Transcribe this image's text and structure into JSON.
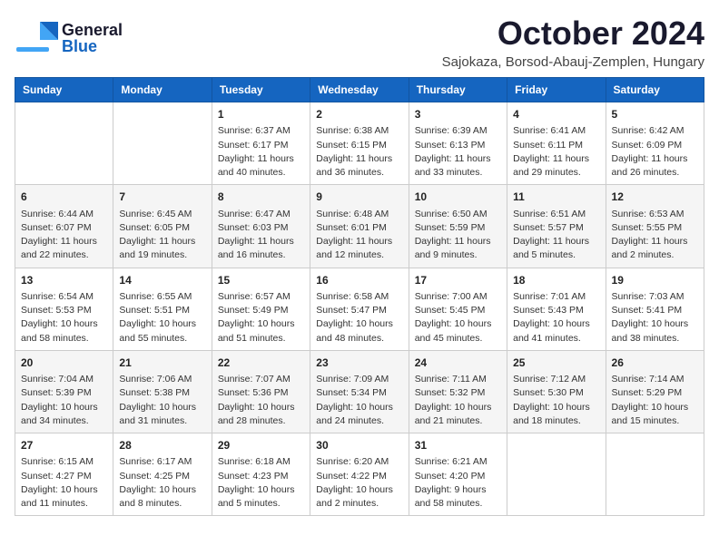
{
  "header": {
    "logo": {
      "line1": "General",
      "line2": "Blue"
    },
    "title": "October 2024",
    "subtitle": "Sajokaza, Borsod-Abauj-Zemplen, Hungary"
  },
  "days_of_week": [
    "Sunday",
    "Monday",
    "Tuesday",
    "Wednesday",
    "Thursday",
    "Friday",
    "Saturday"
  ],
  "weeks": [
    [
      {
        "day": "",
        "content": ""
      },
      {
        "day": "",
        "content": ""
      },
      {
        "day": "1",
        "content": "Sunrise: 6:37 AM\nSunset: 6:17 PM\nDaylight: 11 hours and 40 minutes."
      },
      {
        "day": "2",
        "content": "Sunrise: 6:38 AM\nSunset: 6:15 PM\nDaylight: 11 hours and 36 minutes."
      },
      {
        "day": "3",
        "content": "Sunrise: 6:39 AM\nSunset: 6:13 PM\nDaylight: 11 hours and 33 minutes."
      },
      {
        "day": "4",
        "content": "Sunrise: 6:41 AM\nSunset: 6:11 PM\nDaylight: 11 hours and 29 minutes."
      },
      {
        "day": "5",
        "content": "Sunrise: 6:42 AM\nSunset: 6:09 PM\nDaylight: 11 hours and 26 minutes."
      }
    ],
    [
      {
        "day": "6",
        "content": "Sunrise: 6:44 AM\nSunset: 6:07 PM\nDaylight: 11 hours and 22 minutes."
      },
      {
        "day": "7",
        "content": "Sunrise: 6:45 AM\nSunset: 6:05 PM\nDaylight: 11 hours and 19 minutes."
      },
      {
        "day": "8",
        "content": "Sunrise: 6:47 AM\nSunset: 6:03 PM\nDaylight: 11 hours and 16 minutes."
      },
      {
        "day": "9",
        "content": "Sunrise: 6:48 AM\nSunset: 6:01 PM\nDaylight: 11 hours and 12 minutes."
      },
      {
        "day": "10",
        "content": "Sunrise: 6:50 AM\nSunset: 5:59 PM\nDaylight: 11 hours and 9 minutes."
      },
      {
        "day": "11",
        "content": "Sunrise: 6:51 AM\nSunset: 5:57 PM\nDaylight: 11 hours and 5 minutes."
      },
      {
        "day": "12",
        "content": "Sunrise: 6:53 AM\nSunset: 5:55 PM\nDaylight: 11 hours and 2 minutes."
      }
    ],
    [
      {
        "day": "13",
        "content": "Sunrise: 6:54 AM\nSunset: 5:53 PM\nDaylight: 10 hours and 58 minutes."
      },
      {
        "day": "14",
        "content": "Sunrise: 6:55 AM\nSunset: 5:51 PM\nDaylight: 10 hours and 55 minutes."
      },
      {
        "day": "15",
        "content": "Sunrise: 6:57 AM\nSunset: 5:49 PM\nDaylight: 10 hours and 51 minutes."
      },
      {
        "day": "16",
        "content": "Sunrise: 6:58 AM\nSunset: 5:47 PM\nDaylight: 10 hours and 48 minutes."
      },
      {
        "day": "17",
        "content": "Sunrise: 7:00 AM\nSunset: 5:45 PM\nDaylight: 10 hours and 45 minutes."
      },
      {
        "day": "18",
        "content": "Sunrise: 7:01 AM\nSunset: 5:43 PM\nDaylight: 10 hours and 41 minutes."
      },
      {
        "day": "19",
        "content": "Sunrise: 7:03 AM\nSunset: 5:41 PM\nDaylight: 10 hours and 38 minutes."
      }
    ],
    [
      {
        "day": "20",
        "content": "Sunrise: 7:04 AM\nSunset: 5:39 PM\nDaylight: 10 hours and 34 minutes."
      },
      {
        "day": "21",
        "content": "Sunrise: 7:06 AM\nSunset: 5:38 PM\nDaylight: 10 hours and 31 minutes."
      },
      {
        "day": "22",
        "content": "Sunrise: 7:07 AM\nSunset: 5:36 PM\nDaylight: 10 hours and 28 minutes."
      },
      {
        "day": "23",
        "content": "Sunrise: 7:09 AM\nSunset: 5:34 PM\nDaylight: 10 hours and 24 minutes."
      },
      {
        "day": "24",
        "content": "Sunrise: 7:11 AM\nSunset: 5:32 PM\nDaylight: 10 hours and 21 minutes."
      },
      {
        "day": "25",
        "content": "Sunrise: 7:12 AM\nSunset: 5:30 PM\nDaylight: 10 hours and 18 minutes."
      },
      {
        "day": "26",
        "content": "Sunrise: 7:14 AM\nSunset: 5:29 PM\nDaylight: 10 hours and 15 minutes."
      }
    ],
    [
      {
        "day": "27",
        "content": "Sunrise: 6:15 AM\nSunset: 4:27 PM\nDaylight: 10 hours and 11 minutes."
      },
      {
        "day": "28",
        "content": "Sunrise: 6:17 AM\nSunset: 4:25 PM\nDaylight: 10 hours and 8 minutes."
      },
      {
        "day": "29",
        "content": "Sunrise: 6:18 AM\nSunset: 4:23 PM\nDaylight: 10 hours and 5 minutes."
      },
      {
        "day": "30",
        "content": "Sunrise: 6:20 AM\nSunset: 4:22 PM\nDaylight: 10 hours and 2 minutes."
      },
      {
        "day": "31",
        "content": "Sunrise: 6:21 AM\nSunset: 4:20 PM\nDaylight: 9 hours and 58 minutes."
      },
      {
        "day": "",
        "content": ""
      },
      {
        "day": "",
        "content": ""
      }
    ]
  ]
}
